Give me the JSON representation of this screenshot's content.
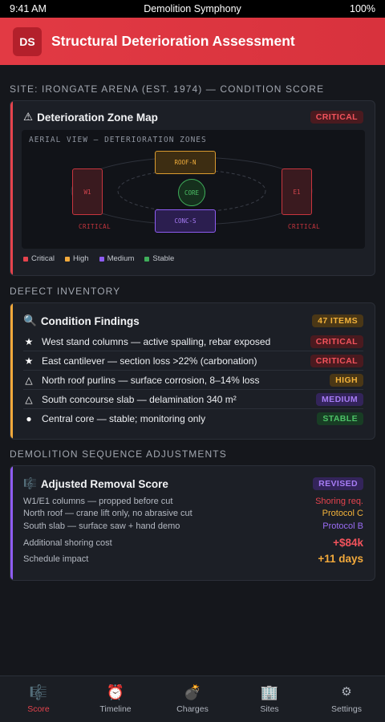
{
  "status_bar": {
    "time": "9:41 AM",
    "app_name": "Demolition Symphony",
    "battery": "100%"
  },
  "app_bar": {
    "logo_initials": "DS",
    "title": "Structural Deterioration Assessment"
  },
  "site_section": {
    "label": "SITE: IRONGATE ARENA (EST. 1974) — CONDITION SCORE",
    "card": {
      "icon": "⚠",
      "icon_name": "warning-icon",
      "title": "Deterioration Zone Map",
      "badge": "CRITICAL",
      "map": {
        "caption": "AERIAL VIEW — DETERIORATION ZONES",
        "zones": [
          {
            "id": "w1",
            "label": "W1",
            "severity": "critical",
            "tag": "CRITICAL"
          },
          {
            "id": "roof-n",
            "label": "ROOF-N",
            "severity": "high"
          },
          {
            "id": "core",
            "label": "CORE",
            "severity": "stable"
          },
          {
            "id": "conc-s",
            "label": "CONC-S",
            "severity": "medium"
          },
          {
            "id": "e1",
            "label": "E1",
            "severity": "critical",
            "tag": "CRITICAL"
          }
        ]
      },
      "legend": [
        {
          "label": "Critical",
          "color": "#e5434d"
        },
        {
          "label": "High",
          "color": "#f2a93b"
        },
        {
          "label": "Medium",
          "color": "#8e5cf2"
        },
        {
          "label": "Stable",
          "color": "#3fae5a"
        }
      ]
    }
  },
  "defect_section": {
    "label": "DEFECT INVENTORY",
    "card": {
      "icon": "🔍",
      "icon_name": "magnifier-icon",
      "title": "Condition Findings",
      "badge": "47 ITEMS",
      "findings": [
        {
          "glyph": "★",
          "icon_name": "star-icon",
          "text": "West stand columns — active spalling, rebar exposed",
          "badge": "CRITICAL",
          "severity": "critical"
        },
        {
          "glyph": "★",
          "icon_name": "star-icon",
          "text": "East cantilever — section loss >22% (carbonation)",
          "badge": "CRITICAL",
          "severity": "critical"
        },
        {
          "glyph": "△",
          "icon_name": "triangle-icon",
          "text": "North roof purlins — surface corrosion, 8–14% loss",
          "badge": "HIGH",
          "severity": "high"
        },
        {
          "glyph": "△",
          "icon_name": "triangle-icon",
          "text": "South concourse slab — delamination 340 m²",
          "badge": "MEDIUM",
          "severity": "medium"
        },
        {
          "glyph": "●",
          "icon_name": "circle-icon",
          "text": "Central core — stable; monitoring only",
          "badge": "STABLE",
          "severity": "stable"
        }
      ]
    }
  },
  "sequence_section": {
    "label": "DEMOLITION SEQUENCE ADJUSTMENTS",
    "card": {
      "icon": "🎼",
      "icon_name": "score-icon",
      "title": "Adjusted Removal Score",
      "badge": "REVISED",
      "rows": [
        {
          "label": "W1/E1 columns — propped before cut",
          "value": "Shoring req.",
          "color": "#e5434d"
        },
        {
          "label": "North roof — crane lift only, no abrasive cut",
          "value": "Protocol C",
          "color": "#f2b23a"
        },
        {
          "label": "South slab — surface saw + hand demo",
          "value": "Protocol B",
          "color": "#9a6cf5"
        }
      ],
      "totals": [
        {
          "label": "Additional shoring cost",
          "value": "+$84k",
          "color": "#f2535c"
        },
        {
          "label": "Schedule impact",
          "value": "+11 days",
          "color": "#f2a93b"
        }
      ]
    }
  },
  "bottom_nav": [
    {
      "label": "Score",
      "icon": "🎼",
      "icon_name": "score-icon",
      "active": true
    },
    {
      "label": "Timeline",
      "icon": "⏰",
      "icon_name": "alarm-clock-icon",
      "active": false
    },
    {
      "label": "Charges",
      "icon": "💣",
      "icon_name": "bomb-icon",
      "active": false
    },
    {
      "label": "Sites",
      "icon": "🏢",
      "icon_name": "building-icon",
      "active": false
    },
    {
      "label": "Settings",
      "icon": "⚙",
      "icon_name": "gear-icon",
      "active": false
    }
  ]
}
